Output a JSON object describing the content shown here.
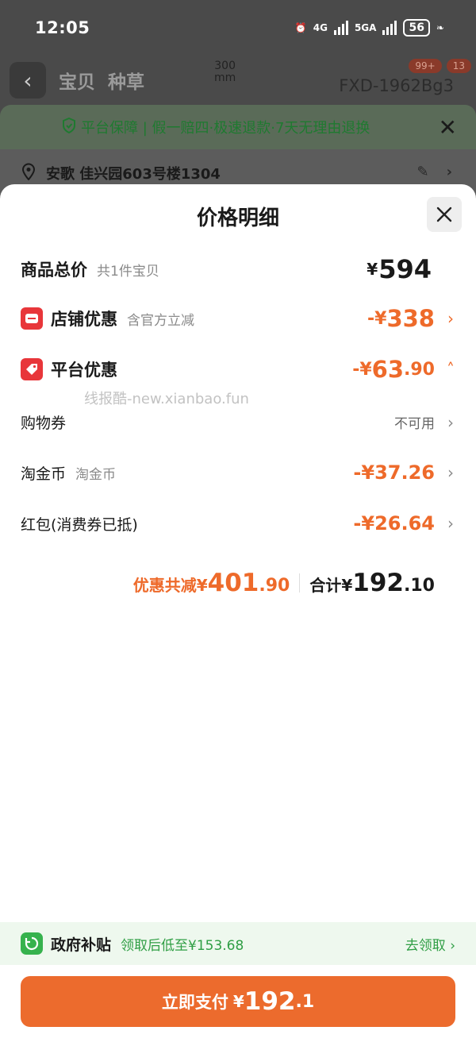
{
  "status_bar": {
    "time": "12:05",
    "network_1": "4G",
    "network_2": "5GA",
    "battery": "56"
  },
  "background_page": {
    "tabs": [
      "宝贝",
      "种草"
    ],
    "dimension_label": "300\nmm",
    "product_code": "FXD-1962Bg3",
    "badges": [
      "99+",
      "13"
    ],
    "guarantee_text": "平台保障 | 假一赔四·极速退款·7天无理由退换",
    "address": "安歌 佳兴园603号楼1304"
  },
  "sheet": {
    "title": "价格明细",
    "goods_total": {
      "label": "商品总价",
      "sub": "共1件宝贝",
      "yen": "¥",
      "amount": "594"
    },
    "shop_discount": {
      "label": "店铺优惠",
      "sub": "含官方立减",
      "prefix": "-¥",
      "amount": "338"
    },
    "platform_discount": {
      "label": "平台优惠",
      "prefix": "-¥",
      "amount": "63",
      "decimal": ".90"
    },
    "watermark": "线报酷-new.xianbao.fun",
    "items": [
      {
        "label": "购物券",
        "sub": "",
        "value": "不可用"
      },
      {
        "label": "淘金币",
        "sub": "淘金币",
        "value": "-¥37.26"
      },
      {
        "label": "红包(消费券已抵)",
        "sub": "",
        "value": "-¥26.64"
      }
    ],
    "summary": {
      "discount_label": "优惠共减",
      "discount_yen": "¥",
      "discount_int": "401",
      "discount_dec": ".90",
      "total_label": "合计",
      "total_yen": "¥",
      "total_int": "192",
      "total_dec": ".10"
    }
  },
  "subsidy": {
    "title": "政府补贴",
    "desc": "领取后低至¥153.68",
    "link": "去领取"
  },
  "pay_button": {
    "label": "立即支付",
    "yen": "¥",
    "amount": "192",
    "decimal": ".1"
  },
  "colors": {
    "accent_orange": "#ec6b2d",
    "discount_orange": "#ee6a2a",
    "red_icon": "#e8363a",
    "green": "#36b24d"
  }
}
